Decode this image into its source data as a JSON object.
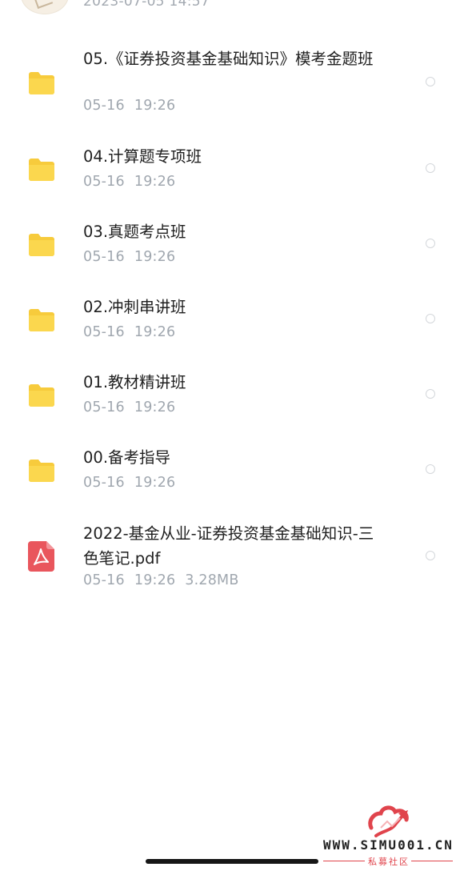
{
  "previous_item": {
    "timestamp": "2023-07-05 14:57"
  },
  "files": [
    {
      "name": "05.《证券投资基金基础知识》模考金题班",
      "date": "05-16",
      "time": "19:26",
      "size": "",
      "icon": "folder-icon"
    },
    {
      "name": "04.计算题专项班",
      "date": "05-16",
      "time": "19:26",
      "size": "",
      "icon": "folder-icon"
    },
    {
      "name": "03.真题考点班",
      "date": "05-16",
      "time": "19:26",
      "size": "",
      "icon": "folder-icon"
    },
    {
      "name": "02.冲刺串讲班",
      "date": "05-16",
      "time": "19:26",
      "size": "",
      "icon": "folder-icon"
    },
    {
      "name": "01.教材精讲班",
      "date": "05-16",
      "time": "19:26",
      "size": "",
      "icon": "folder-icon"
    },
    {
      "name": "00.备考指导",
      "date": "05-16",
      "time": "19:26",
      "size": "",
      "icon": "folder-icon"
    },
    {
      "name": "2022-基金从业-证券投资基金基础知识-三色笔记.pdf",
      "date": "05-16",
      "time": "19:26",
      "size": "3.28MB",
      "icon": "pdf-icon"
    }
  ],
  "watermark": {
    "text": "WWW.SIMU001.CN",
    "subtitle": "私募社区"
  },
  "colors": {
    "folder": "#fbd74e",
    "pdf": "#e9565d",
    "meta_text": "#a0a7af",
    "watermark_red": "#e0444c"
  }
}
